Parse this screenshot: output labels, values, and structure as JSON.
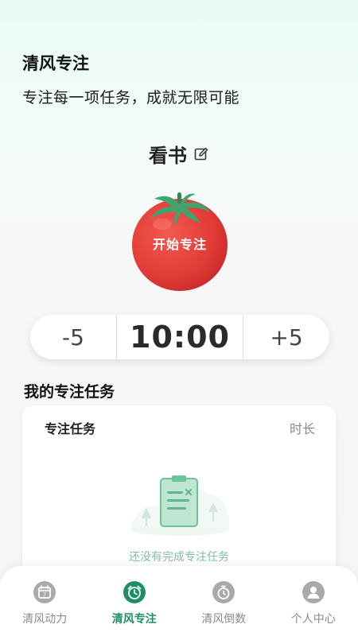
{
  "header": {
    "title": "清风专注",
    "subtitle": "专注每一项任务，成就无限可能"
  },
  "focus": {
    "task_name": "看书",
    "edit_icon": "edit-icon",
    "start_label": "开始专注",
    "tomato_color": "#e5433f"
  },
  "timer": {
    "minus_label": "-5",
    "value": "10:00",
    "plus_label": "+5"
  },
  "tasks_section": {
    "title": "我的专注任务",
    "column_task": "专注任务",
    "column_duration": "时长",
    "empty_text": "还没有完成专注任务"
  },
  "tabbar": {
    "accent_color": "#1f8f63",
    "inactive_color": "#a9a9a9",
    "items": [
      {
        "label": "清风动力",
        "icon": "calendar-icon",
        "active": false
      },
      {
        "label": "清风专注",
        "icon": "alarm-clock-icon",
        "active": true
      },
      {
        "label": "清风倒数",
        "icon": "stopwatch-icon",
        "active": false
      },
      {
        "label": "个人中心",
        "icon": "user-icon",
        "active": false
      }
    ]
  }
}
